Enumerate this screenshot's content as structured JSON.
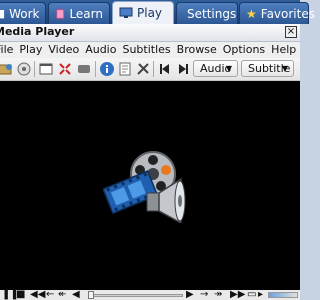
{
  "tabs": [
    {
      "label": "Work",
      "icon": "folder-icon"
    },
    {
      "label": "Learn",
      "icon": "book-icon"
    },
    {
      "label": "Play",
      "icon": "monitor-icon",
      "active": true
    },
    {
      "label": "Settings",
      "icon": "settings-icon"
    },
    {
      "label": "Favorites",
      "icon": "star-icon"
    }
  ],
  "window": {
    "title": "Media Player"
  },
  "menu": [
    "File",
    "Play",
    "Video",
    "Audio",
    "Subtitles",
    "Browse",
    "Options",
    "Help"
  ],
  "toolbar": {
    "audio_label": "Audio",
    "subtitle_label": "Subtitle"
  },
  "colors": {
    "tabbar": "#1f4478",
    "active_tab": "#eef2f8",
    "video_bg": "#000000",
    "accent_blue": "#2a7fd4"
  },
  "playback": {
    "seek_position": 0
  }
}
